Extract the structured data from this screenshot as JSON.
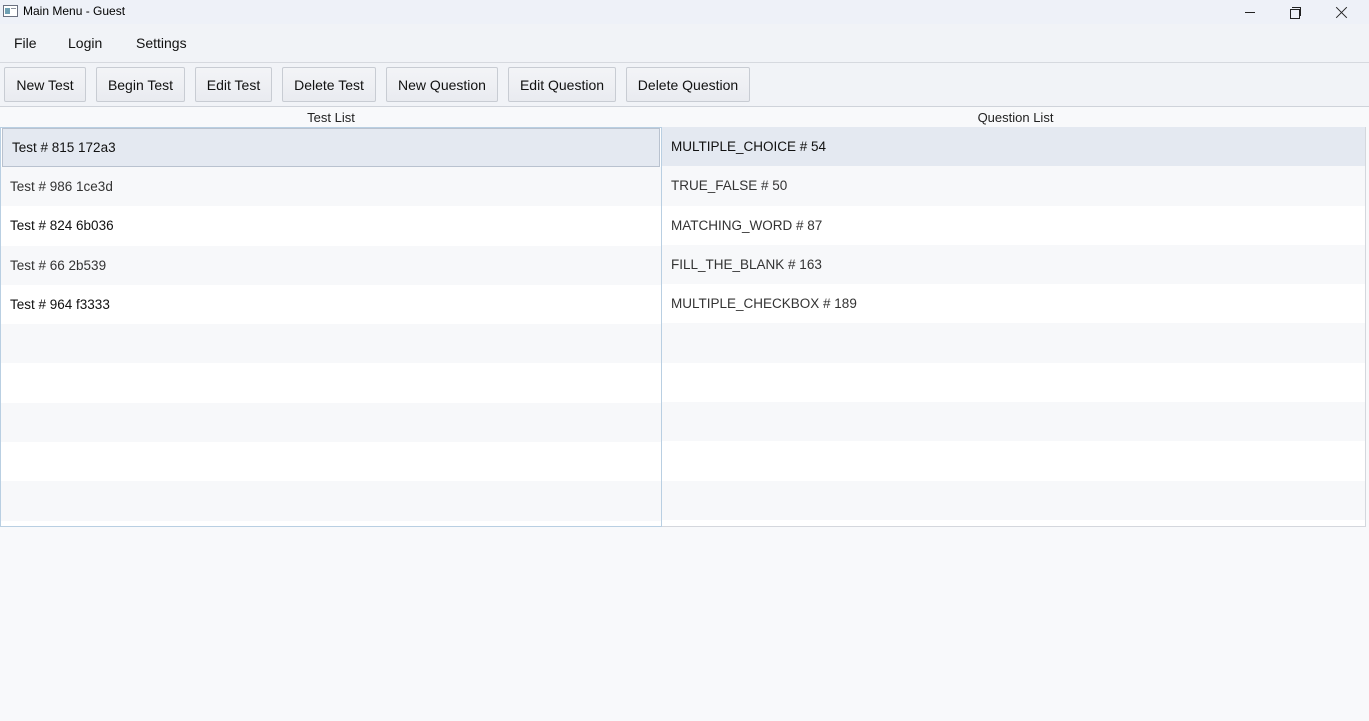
{
  "window": {
    "title": "Main Menu - Guest"
  },
  "menu": {
    "items": [
      {
        "label": "File"
      },
      {
        "label": "Login"
      },
      {
        "label": "Settings"
      }
    ]
  },
  "toolbar": {
    "buttons": [
      {
        "label": "New Test"
      },
      {
        "label": "Begin Test"
      },
      {
        "label": "Edit Test"
      },
      {
        "label": "Delete Test"
      },
      {
        "label": "New Question"
      },
      {
        "label": "Edit Question"
      },
      {
        "label": "Delete Question"
      }
    ]
  },
  "tests": {
    "header": "Test List",
    "rows": [
      "Test # 815 172a3",
      "Test # 986 1ce3d",
      "Test # 824 6b036",
      "Test # 66 2b539",
      "Test # 964 f3333"
    ]
  },
  "questions": {
    "header": "Question List",
    "rows": [
      "MULTIPLE_CHOICE # 54",
      "TRUE_FALSE # 50",
      "MATCHING_WORD # 87",
      "FILL_THE_BLANK # 163",
      "MULTIPLE_CHECKBOX # 189"
    ]
  },
  "icons": {
    "app": "app-window-icon",
    "minimize": "minimize-icon",
    "maximize": "restore-icon",
    "close": "close-icon"
  }
}
